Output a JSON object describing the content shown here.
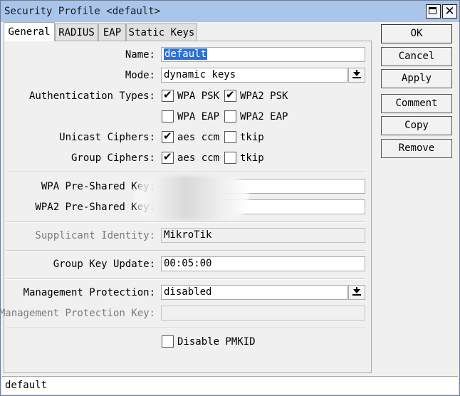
{
  "window": {
    "title": "Security Profile <default>"
  },
  "tabs": [
    {
      "label": "General"
    },
    {
      "label": "RADIUS"
    },
    {
      "label": "EAP"
    },
    {
      "label": "Static Keys"
    }
  ],
  "form": {
    "name": {
      "label": "Name:",
      "value": "default"
    },
    "mode": {
      "label": "Mode:",
      "value": "dynamic keys"
    },
    "auth_types": {
      "label": "Authentication Types:",
      "options": [
        {
          "label": "WPA PSK",
          "checked": true
        },
        {
          "label": "WPA2 PSK",
          "checked": true
        },
        {
          "label": "WPA EAP",
          "checked": false
        },
        {
          "label": "WPA2 EAP",
          "checked": false
        }
      ]
    },
    "unicast_ciphers": {
      "label": "Unicast Ciphers:",
      "options": [
        {
          "label": "aes ccm",
          "checked": true
        },
        {
          "label": "tkip",
          "checked": false
        }
      ]
    },
    "group_ciphers": {
      "label": "Group Ciphers:",
      "options": [
        {
          "label": "aes ccm",
          "checked": true
        },
        {
          "label": "tkip",
          "checked": false
        }
      ]
    },
    "wpa_psk": {
      "label": "WPA Pre-Shared Key:",
      "value": ""
    },
    "wpa2_psk": {
      "label": "WPA2 Pre-Shared Key:",
      "value": ""
    },
    "supplicant_identity": {
      "label": "Supplicant Identity:",
      "value": "MikroTik"
    },
    "group_key_update": {
      "label": "Group Key Update:",
      "value": "00:05:00"
    },
    "mgmt_protection": {
      "label": "Management Protection:",
      "value": "disabled"
    },
    "mgmt_protection_key": {
      "label": "Management Protection Key:",
      "value": ""
    },
    "disable_pmkid": {
      "label": "Disable PMKID",
      "checked": false
    }
  },
  "buttons": {
    "ok": "OK",
    "cancel": "Cancel",
    "apply": "Apply",
    "comment": "Comment",
    "copy": "Copy",
    "remove": "Remove"
  },
  "status": {
    "text": "default"
  },
  "icons": {
    "checkmark": "✔",
    "close": "✕",
    "maximize": "window-maximize",
    "dropdown": "arrow-down-to-bar"
  },
  "colors": {
    "titlebar": "#a9c5ea",
    "selection": "#2f6fd1"
  }
}
